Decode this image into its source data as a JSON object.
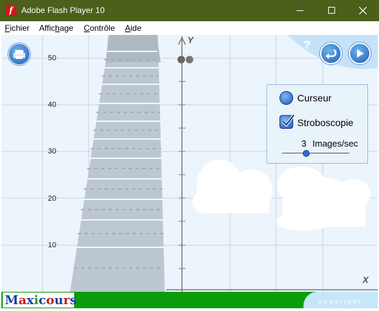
{
  "window": {
    "title": "Adobe Flash Player 10"
  },
  "menu": [
    {
      "pre": "",
      "ul": "F",
      "post": "ichier"
    },
    {
      "pre": "Affic",
      "ul": "h",
      "post": "age"
    },
    {
      "pre": "",
      "ul": "C",
      "post": "ontrôle"
    },
    {
      "pre": "",
      "ul": "A",
      "post": "ide"
    }
  ],
  "graph": {
    "y_axis_label": "Y",
    "x_axis_label": "X",
    "y_ticks": [
      "50",
      "40",
      "30",
      "20",
      "10"
    ]
  },
  "toolbar": {
    "help_symbol": "?"
  },
  "panel": {
    "cursor_label": "Curseur",
    "stroboscopy_label": "Stroboscopie",
    "rate_value": "3",
    "rate_unit": "Images/sec",
    "stroboscopy_checked": true
  },
  "footer": {
    "logo_text": "Maxicours",
    "copyright": "copyright"
  },
  "colors": {
    "titlebar": "#4c5f1b",
    "stage_bg": "#ecf4fc",
    "footer_green": "#0c9c0c",
    "button_blue": "#1e5fb8"
  }
}
